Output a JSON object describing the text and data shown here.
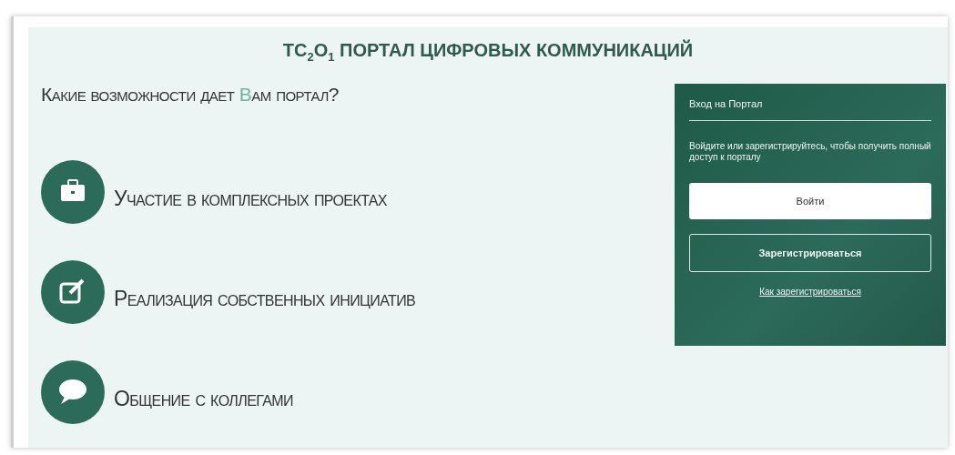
{
  "title": "TC$_{2}$O$_{1}$ ПОРТАЛ ЦИФРОВЫХ КОММУНИКАЦИЙ",
  "question": "Какие возможности дает **В**ам портал?",
  "features": [
    {
      "kind": "briefcase",
      "label": "Участие в комплексных проектах"
    },
    {
      "kind": "edit",
      "label": "Реализация собственных инициатив"
    },
    {
      "kind": "chat",
      "label": "Общение с коллегами"
    }
  ],
  "login": {
    "title": "Вход на Портал",
    "text": "Войдите или зарегистрируйтесь, чтобы получить полный доступ к порталу",
    "login_button": "Войти",
    "register_button": "Зарегистрироваться",
    "help_link": "Как зарегистрироваться"
  }
}
